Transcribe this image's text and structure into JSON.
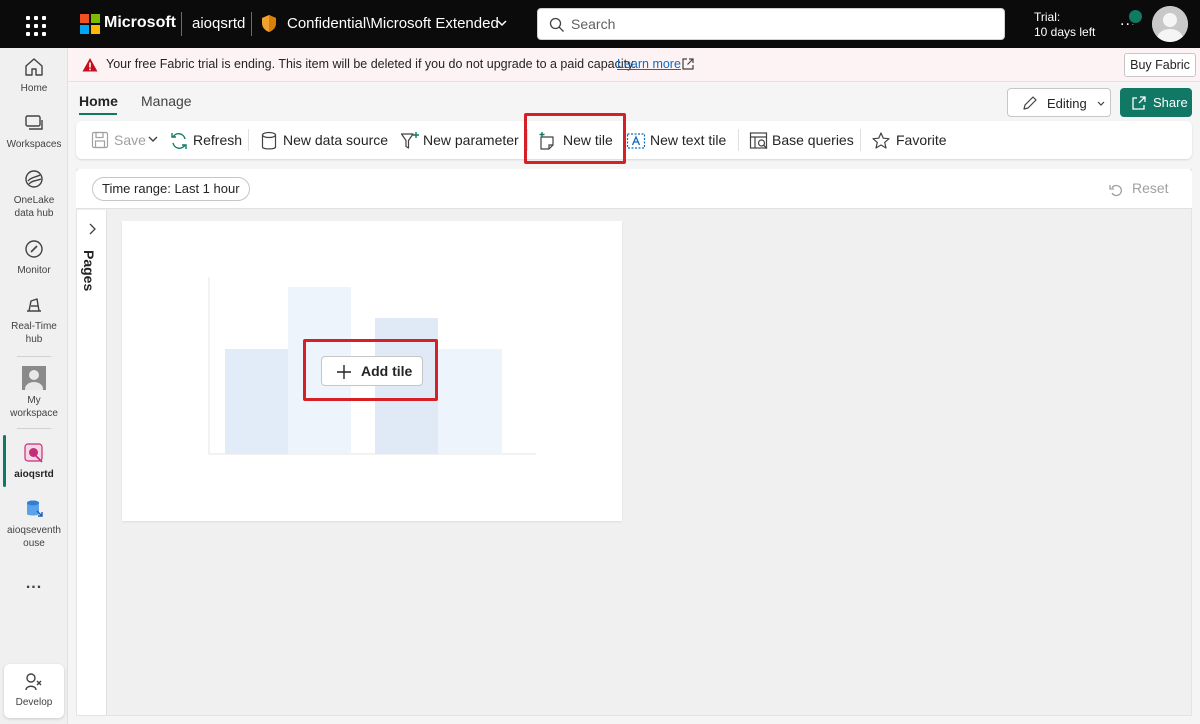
{
  "topbar": {
    "brand": "Microsoft",
    "workspace": "aioqsrtd",
    "sensitivity_label": "Confidential\\Microsoft Extended",
    "search_placeholder": "Search",
    "trial_line1": "Trial:",
    "trial_line2": "10 days left",
    "more": "..."
  },
  "leftnav": {
    "items": [
      {
        "label": "Home",
        "icon": "home-icon"
      },
      {
        "label": "Workspaces",
        "icon": "workspaces-icon"
      },
      {
        "label": "OneLake data hub",
        "icon": "onelake-icon"
      },
      {
        "label": "Monitor",
        "icon": "monitor-icon"
      },
      {
        "label": "Real-Time hub",
        "icon": "realtime-hub-icon"
      },
      {
        "label": "My workspace",
        "icon": "my-workspace-icon"
      },
      {
        "label": "aioqsrtd",
        "icon": "dashboard-icon"
      },
      {
        "label": "aioqseventh ouse",
        "icon": "eventhouse-icon"
      }
    ],
    "more": "...",
    "develop": "Develop"
  },
  "banner": {
    "text": "Your free Fabric trial is ending. This item will be deleted if you do not upgrade to a paid capacity.",
    "link": "Learn more",
    "buy_button": "Buy Fabric"
  },
  "tabs": {
    "home": "Home",
    "manage": "Manage"
  },
  "header_actions": {
    "editing": "Editing",
    "share": "Share"
  },
  "toolbar": {
    "save": "Save",
    "refresh": "Refresh",
    "new_data_source": "New data source",
    "new_parameter": "New parameter",
    "new_tile": "New tile",
    "new_text_tile": "New text tile",
    "base_queries": "Base queries",
    "favorite": "Favorite"
  },
  "filters": {
    "time_range": "Time range: Last 1 hour",
    "reset": "Reset"
  },
  "pages_label": "Pages",
  "tile": {
    "add_tile": "Add tile"
  },
  "colors": {
    "accent": "#117865",
    "highlight": "#d61f26",
    "topbar": "#0b0b0b",
    "link": "#0f6cbd"
  }
}
